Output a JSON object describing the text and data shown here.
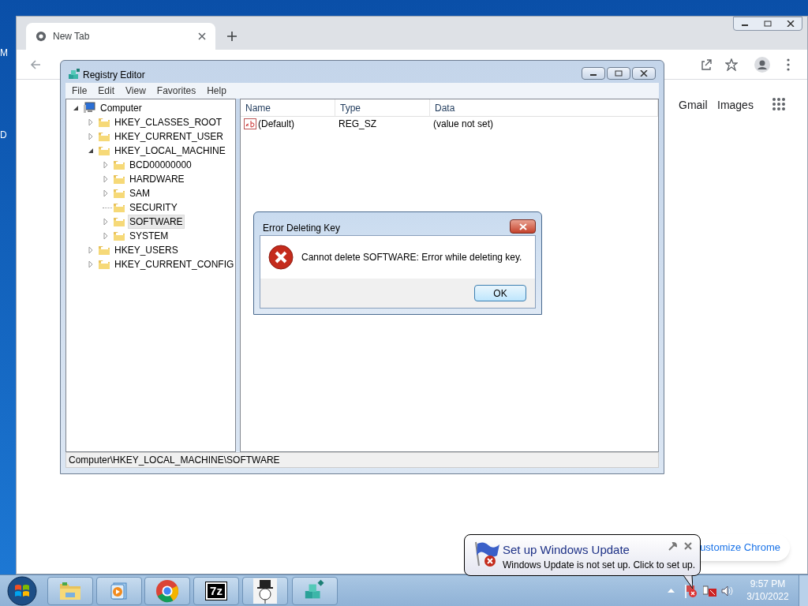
{
  "desktop": {
    "labels": [
      "M",
      "D"
    ]
  },
  "browser": {
    "tab": {
      "title": "New Tab"
    },
    "links": [
      "Gmail",
      "Images"
    ],
    "customize": "ustomize Chrome"
  },
  "regedit": {
    "title": "Registry Editor",
    "menu": [
      "File",
      "Edit",
      "View",
      "Favorites",
      "Help"
    ],
    "tree": [
      {
        "label": "Computer",
        "kind": "computer",
        "expanded": true,
        "selected": false,
        "children": [
          {
            "label": "HKEY_CLASSES_ROOT",
            "kind": "folder",
            "expanded": false,
            "selected": false
          },
          {
            "label": "HKEY_CURRENT_USER",
            "kind": "folder",
            "expanded": false,
            "selected": false
          },
          {
            "label": "HKEY_LOCAL_MACHINE",
            "kind": "folder",
            "expanded": true,
            "selected": false,
            "children": [
              {
                "label": "BCD00000000",
                "kind": "folder",
                "expanded": false,
                "selected": false
              },
              {
                "label": "HARDWARE",
                "kind": "folder",
                "expanded": false,
                "selected": false
              },
              {
                "label": "SAM",
                "kind": "folder",
                "expanded": false,
                "selected": false
              },
              {
                "label": "SECURITY",
                "kind": "folder",
                "selected": false
              },
              {
                "label": "SOFTWARE",
                "kind": "folder",
                "expanded": false,
                "selected": true
              },
              {
                "label": "SYSTEM",
                "kind": "folder",
                "expanded": false,
                "selected": false
              }
            ]
          },
          {
            "label": "HKEY_USERS",
            "kind": "folder",
            "expanded": false,
            "selected": false
          },
          {
            "label": "HKEY_CURRENT_CONFIG",
            "kind": "folder",
            "expanded": false,
            "selected": false
          }
        ]
      }
    ],
    "columns": [
      "Name",
      "Type",
      "Data"
    ],
    "rows": [
      [
        "(Default)",
        "REG_SZ",
        "(value not set)"
      ]
    ],
    "status_bar": "Computer\\HKEY_LOCAL_MACHINE\\SOFTWARE"
  },
  "dialog": {
    "title": "Error Deleting Key",
    "message": "Cannot delete SOFTWARE:  Error while deleting key.",
    "button": "OK"
  },
  "balloon": {
    "title": "Set up Windows Update",
    "message": "Windows Update is not set up. Click to set up."
  },
  "taskbar": {
    "items": [
      {
        "kind": "explorer"
      },
      {
        "kind": "media"
      },
      {
        "kind": "chrome"
      },
      {
        "kind": "sevenzip",
        "label": "7z"
      },
      {
        "kind": "figure"
      },
      {
        "kind": "regedit"
      }
    ],
    "time": "9:57 PM",
    "date": "3/10/2022"
  }
}
